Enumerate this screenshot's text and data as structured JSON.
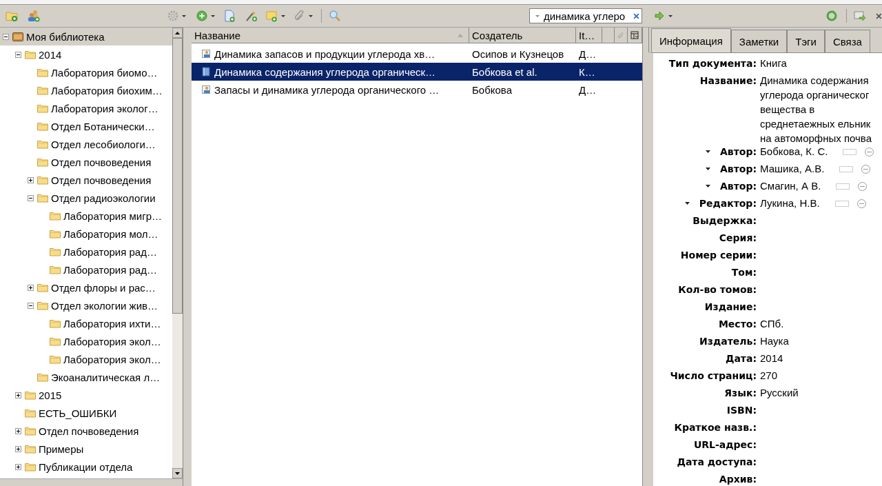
{
  "toolbar": {
    "search": {
      "value": "динамика углеро"
    }
  },
  "collections": [
    {
      "label": "Моя библиотека",
      "kind": "library",
      "selected": true,
      "expanded": true,
      "children": [
        {
          "label": "2014",
          "kind": "folder",
          "selected": false,
          "expanded": true,
          "children": [
            {
              "label": "Лаборатория биомо…",
              "kind": "folder",
              "selected": false
            },
            {
              "label": "Лаборатория биохим…",
              "kind": "folder",
              "selected": false
            },
            {
              "label": "Лаборатория эколог…",
              "kind": "folder",
              "selected": false
            },
            {
              "label": "Отдел Ботанически…",
              "kind": "folder",
              "selected": false
            },
            {
              "label": "Отдел лесобиологи…",
              "kind": "folder",
              "selected": false
            },
            {
              "label": "Отдел почвоведения",
              "kind": "folder",
              "selected": false
            },
            {
              "label": "Отдел почвоведения",
              "kind": "folder",
              "selected": false,
              "expanded": false
            },
            {
              "label": "Отдел радиоэкологии",
              "kind": "folder",
              "selected": false,
              "expanded": true,
              "children": [
                {
                  "label": "Лаборатория мигр…",
                  "kind": "folder",
                  "selected": false
                },
                {
                  "label": "Лаборатория мол…",
                  "kind": "folder",
                  "selected": false
                },
                {
                  "label": "Лаборатория рад…",
                  "kind": "folder",
                  "selected": false
                },
                {
                  "label": "Лаборатория рад…",
                  "kind": "folder",
                  "selected": false
                }
              ]
            },
            {
              "label": "Отдел флоры и рас…",
              "kind": "folder",
              "selected": false,
              "expanded": false
            },
            {
              "label": "Отдел экологии жив…",
              "kind": "folder",
              "selected": false,
              "expanded": true,
              "children": [
                {
                  "label": "Лаборатория ихти…",
                  "kind": "folder",
                  "selected": false
                },
                {
                  "label": "Лаборатория экол…",
                  "kind": "folder",
                  "selected": false
                },
                {
                  "label": "Лаборатория экол…",
                  "kind": "folder",
                  "selected": false
                }
              ]
            },
            {
              "label": "Экоаналитическая л…",
              "kind": "folder",
              "selected": false
            }
          ]
        },
        {
          "label": "2015",
          "kind": "folder",
          "selected": false,
          "expanded": false
        },
        {
          "label": "ЕСТЬ_ОШИБКИ",
          "kind": "folder",
          "selected": false
        },
        {
          "label": "Отдел почвоведения",
          "kind": "folder",
          "selected": false,
          "expanded": false
        },
        {
          "label": "Примеры",
          "kind": "folder",
          "selected": false,
          "expanded": false
        },
        {
          "label": "Публикации отдела",
          "kind": "folder",
          "selected": false,
          "expanded": false
        }
      ]
    }
  ],
  "items": {
    "columns": [
      {
        "label": "Название",
        "sorted": true
      },
      {
        "label": "Создатель",
        "sorted": false
      },
      {
        "label": "It…",
        "sorted": false
      }
    ],
    "rows": [
      {
        "kind": "webpage",
        "title": "Динамика запасов и продукции углерода хв…",
        "creator": "Осипов и Кузнецов",
        "type": "Д…",
        "selected": false
      },
      {
        "kind": "book",
        "title": "Динамика содержания углерода органическ…",
        "creator": "Бобкова et al.",
        "type": "К…",
        "selected": true
      },
      {
        "kind": "webpage",
        "title": "Запасы и динамика углерода органического …",
        "creator": "Бобкова",
        "type": "Д…",
        "selected": false
      }
    ]
  },
  "info": {
    "tabs": [
      {
        "label": "Информация",
        "selected": true
      },
      {
        "label": "Заметки",
        "selected": false
      },
      {
        "label": "Тэги",
        "selected": false
      },
      {
        "label": "Связа",
        "selected": false
      }
    ],
    "fields": [
      {
        "kind": "plain",
        "label": "Тип документа:",
        "lines": [
          "Книга"
        ]
      },
      {
        "kind": "plain",
        "label": "Название:",
        "lines": [
          "Динамика содержания",
          "углерода органическог",
          "вещества в",
          "среднетаежных ельник",
          "на автоморфных почва"
        ]
      },
      {
        "kind": "creator",
        "label": "Автор:",
        "lines": [
          "Бобкова, К. С."
        ]
      },
      {
        "kind": "creator",
        "label": "Автор:",
        "lines": [
          "Машика, А.В."
        ]
      },
      {
        "kind": "creator",
        "label": "Автор:",
        "lines": [
          "Смагин, А В."
        ]
      },
      {
        "kind": "creator",
        "label": "Редактор:",
        "lines": [
          "Лукина, Н.В."
        ]
      },
      {
        "kind": "plain",
        "label": "Выдержка:"
      },
      {
        "kind": "plain",
        "label": "Серия:"
      },
      {
        "kind": "plain",
        "label": "Номер серии:"
      },
      {
        "kind": "plain",
        "label": "Том:"
      },
      {
        "kind": "plain",
        "label": "Кол-во томов:"
      },
      {
        "kind": "plain",
        "label": "Издание:"
      },
      {
        "kind": "plain",
        "label": "Место:",
        "lines": [
          "СПб."
        ]
      },
      {
        "kind": "plain",
        "label": "Издатель:",
        "lines": [
          "Наука"
        ]
      },
      {
        "kind": "plain",
        "label": "Дата:",
        "lines": [
          "2014"
        ]
      },
      {
        "kind": "plain",
        "label": "Число страниц:",
        "lines": [
          "270"
        ]
      },
      {
        "kind": "plain",
        "label": "Язык:",
        "lines": [
          "Русский"
        ]
      },
      {
        "kind": "plain",
        "label": "ISBN:"
      },
      {
        "kind": "plain",
        "label": "Краткое назв.:"
      },
      {
        "kind": "plain",
        "label": "URL-адрес:"
      },
      {
        "kind": "plain",
        "label": "Дата доступа:"
      },
      {
        "kind": "plain",
        "label": "Архив:"
      }
    ]
  }
}
